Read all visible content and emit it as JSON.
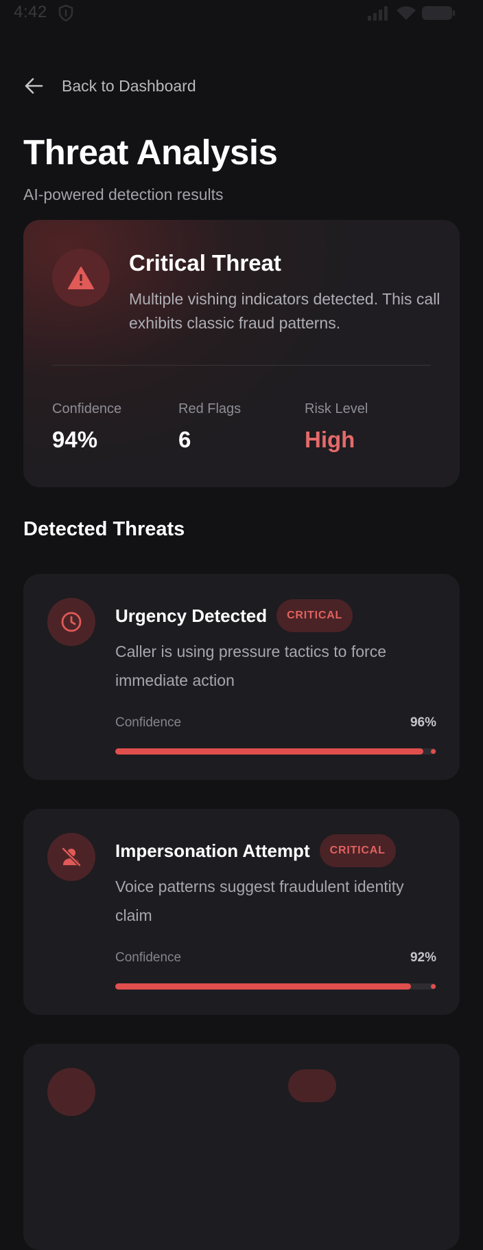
{
  "status_bar": {
    "time": "4:42"
  },
  "nav": {
    "back_label": "Back to Dashboard"
  },
  "page": {
    "title": "Threat Analysis",
    "subtitle": "AI-powered detection results"
  },
  "summary": {
    "title": "Critical Threat",
    "description": "Multiple vishing indicators detected. This call exhibits classic fraud patterns.",
    "stats": [
      {
        "label": "Confidence",
        "value": "94%"
      },
      {
        "label": "Red Flags",
        "value": "6"
      },
      {
        "label": "Risk Level",
        "value": "High"
      }
    ]
  },
  "detected": {
    "section_title": "Detected Threats",
    "threats": [
      {
        "title": "Urgency Detected",
        "badge": "CRITICAL",
        "description": "Caller is using pressure tactics to force immediate action",
        "confidence_label": "Confidence",
        "confidence_text": "96%",
        "confidence": 0.96,
        "icon": "clock-icon"
      },
      {
        "title": "Impersonation Attempt",
        "badge": "CRITICAL",
        "description": "Voice patterns suggest fraudulent identity claim",
        "confidence_label": "Confidence",
        "confidence_text": "92%",
        "confidence": 0.92,
        "icon": "user-off-icon"
      }
    ]
  },
  "colors": {
    "accent_red": "#e04f4d",
    "risk_high": "#e56a6a",
    "background": "#121214",
    "card": "#1d1c20"
  }
}
